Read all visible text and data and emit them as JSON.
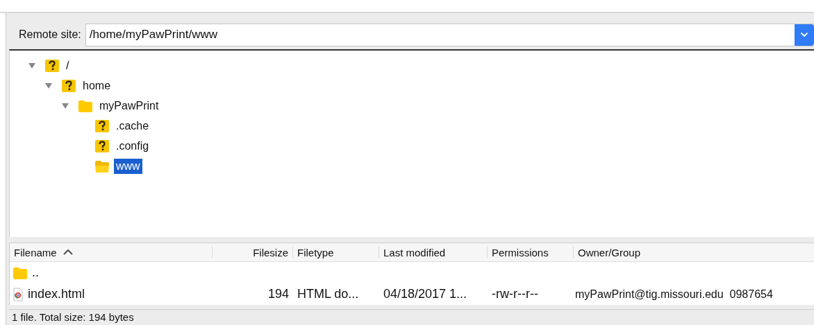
{
  "remote_site": {
    "label": "Remote site:",
    "path": "/home/myPawPrint/www"
  },
  "tree": [
    {
      "name": "/",
      "kind": "unknown",
      "expanded": true,
      "selected": false,
      "children": [
        {
          "name": "home",
          "kind": "unknown",
          "expanded": true,
          "selected": false,
          "children": [
            {
              "name": "myPawPrint",
              "kind": "folder",
              "expanded": true,
              "selected": false,
              "children": [
                {
                  "name": ".cache",
                  "kind": "unknown",
                  "selected": false
                },
                {
                  "name": ".config",
                  "kind": "unknown",
                  "selected": false
                },
                {
                  "name": "www",
                  "kind": "folder",
                  "selected": true
                }
              ]
            }
          ]
        }
      ]
    }
  ],
  "file_list": {
    "columns": [
      {
        "label": "Filename",
        "sorted": true
      },
      {
        "label": "Filesize",
        "sorted": false
      },
      {
        "label": "Filetype",
        "sorted": false
      },
      {
        "label": "Last modified",
        "sorted": false
      },
      {
        "label": "Permissions",
        "sorted": false
      },
      {
        "label": "Owner/Group",
        "sorted": false
      }
    ],
    "rows": [
      {
        "kind": "folder",
        "cells": [
          ".."
        ]
      },
      {
        "kind": "html",
        "cells": [
          "index.html",
          "194",
          "HTML do...",
          "04/18/2017 1...",
          "-rw-r--r--",
          "myPawPrint@tig.missouri.edu  0987654"
        ]
      }
    ]
  },
  "status_bar": "1 file. Total size: 194 bytes"
}
